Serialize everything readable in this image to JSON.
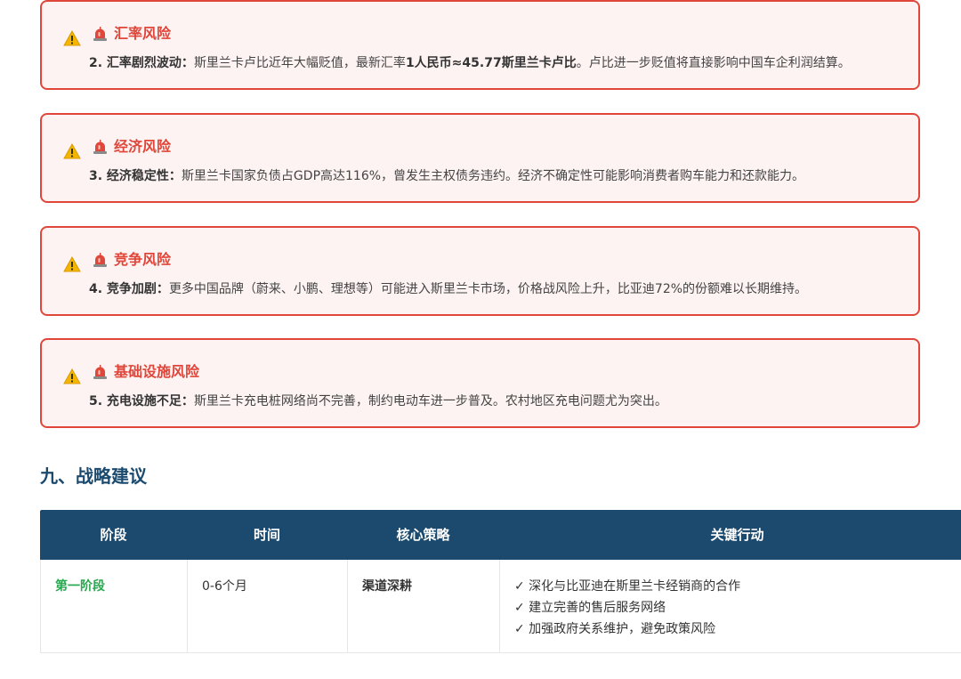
{
  "risks": [
    {
      "title": "汇率风险",
      "label": "2. 汇率剧烈波动：",
      "text_before": "斯里兰卡卢比近年大幅贬值，最新汇率",
      "text_bold": "1人民币≈45.77斯里兰卡卢比",
      "text_after": "。卢比进一步贬值将直接影响中国车企利润结算。"
    },
    {
      "title": "经济风险",
      "label": "3. 经济稳定性：",
      "text_before": "斯里兰卡国家负债占GDP高达116%，曾发生主权债务违约。经济不确定性可能影响消费者购车能力和还款能力。",
      "text_bold": "",
      "text_after": ""
    },
    {
      "title": "竞争风险",
      "label": "4. 竞争加剧：",
      "text_before": "更多中国品牌（蔚来、小鹏、理想等）可能进入斯里兰卡市场，价格战风险上升，比亚迪72%的份额难以长期维持。",
      "text_bold": "",
      "text_after": ""
    },
    {
      "title": "基础设施风险",
      "label": "5. 充电设施不足：",
      "text_before": "斯里兰卡充电桩网络尚不完善，制约电动车进一步普及。农村地区充电问题尤为突出。",
      "text_bold": "",
      "text_after": ""
    }
  ],
  "section": {
    "title": "九、战略建议"
  },
  "table": {
    "headers": [
      "阶段",
      "时间",
      "核心策略",
      "关键行动"
    ],
    "rows": [
      {
        "stage": "第一阶段",
        "time": "0-6个月",
        "core": "渠道深耕",
        "actions": [
          "✓ 深化与比亚迪在斯里兰卡经销商的合作",
          "✓ 建立完善的售后服务网络",
          "✓ 加强政府关系维护，避免政策风险"
        ]
      }
    ]
  },
  "colors": {
    "risk_accent": "#e0473a",
    "risk_bg": "#fdf3f2",
    "header_navy": "#1b4a6e",
    "stage_green": "#27a84f"
  }
}
